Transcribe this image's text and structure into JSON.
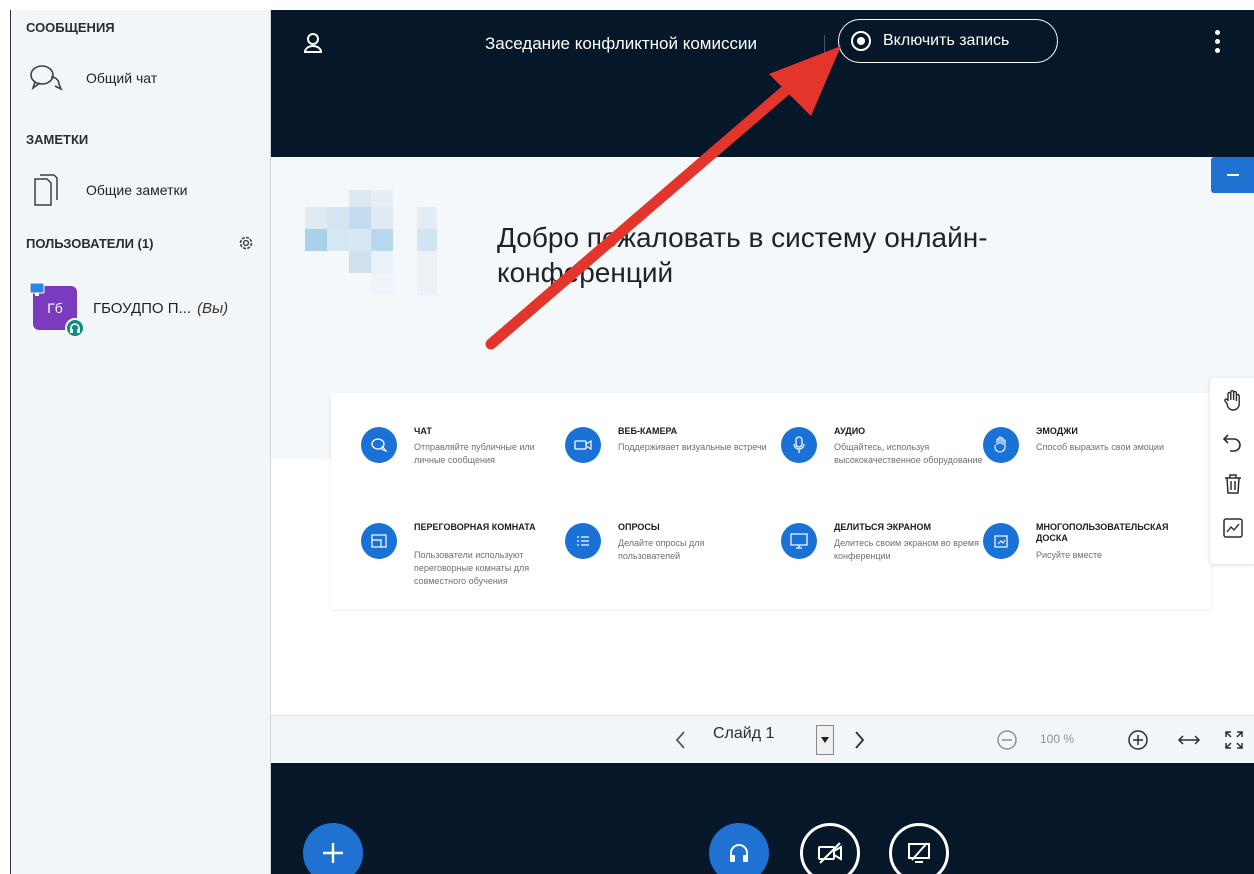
{
  "sidebar": {
    "messages_heading": "СООБЩЕНИЯ",
    "public_chat_label": "Общий чат",
    "notes_heading": "ЗАМЕТКИ",
    "shared_notes_label": "Общие заметки",
    "users_heading": "ПОЛЬЗОВАТЕЛИ (1)",
    "user": {
      "initials": "Гб",
      "name": "ГБОУДПО П...",
      "you_label": "(Вы)"
    }
  },
  "topbar": {
    "meeting_title": "Заседание конфликтной комиссии",
    "record_label": "Включить запись"
  },
  "presentation": {
    "welcome_text": "Добро пожаловать в систему онлайн-конференций",
    "features": [
      {
        "title": "ЧАТ",
        "desc": "Отправляйте публичные или личные сообщения"
      },
      {
        "title": "ВЕБ-КАМЕРА",
        "desc": "Поддерживает визуальные встречи"
      },
      {
        "title": "АУДИО",
        "desc": "Общайтесь, используя высококачественное оборудование"
      },
      {
        "title": "ЭМОДЖИ",
        "desc": "Способ выразить свои эмоции"
      },
      {
        "title": "ПЕРЕГОВОРНАЯ КОМНАТА",
        "desc": "Пользователи используют переговорные комнаты для совместного обучения"
      },
      {
        "title": "ОПРОСЫ",
        "desc": "Делайте опросы для пользователей"
      },
      {
        "title": "ДЕЛИТЬСЯ ЭКРАНОМ",
        "desc": "Делитесь своим экраном во время конференции"
      },
      {
        "title": "МНОГОПОЛЬЗОВАТЕЛЬСКАЯ ДОСКА",
        "desc": "Рисуйте вместе"
      }
    ]
  },
  "slide_controls": {
    "slide_label": "Слайд 1",
    "zoom_label": "100 %"
  },
  "colors": {
    "bar_dark": "#06172a",
    "accent_blue": "#1f72d1",
    "sidebar_bg": "#f3f6f9",
    "avatar_purple": "#7a3bbf",
    "voice_green": "#0f8e7a"
  }
}
